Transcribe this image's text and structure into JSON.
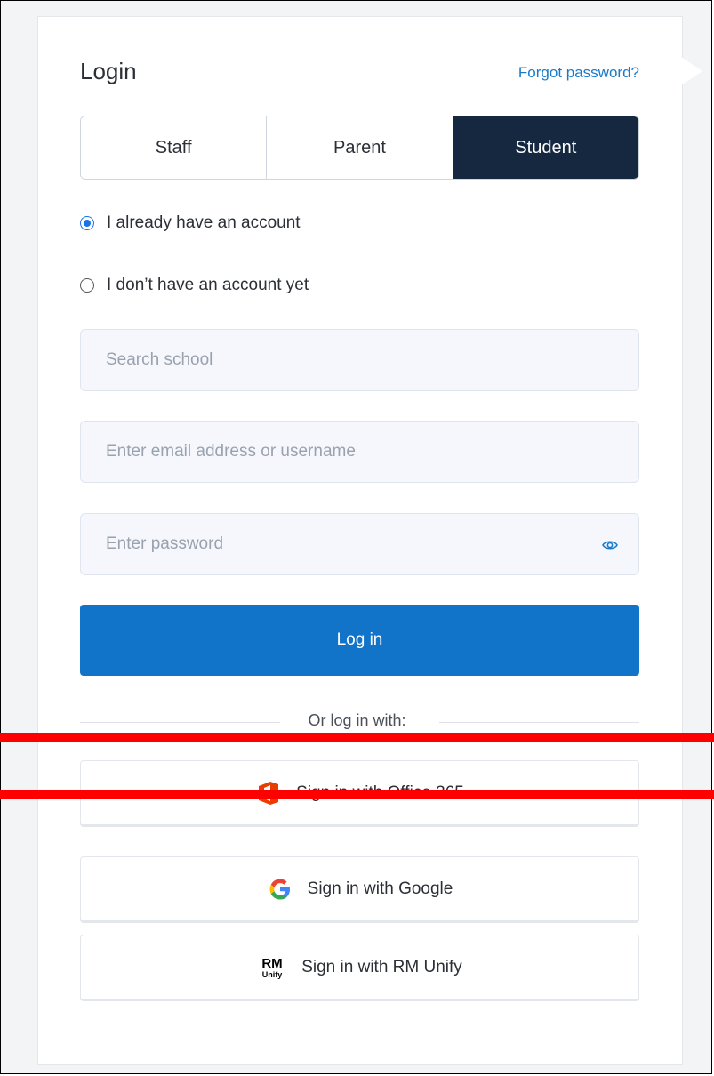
{
  "header": {
    "title": "Login",
    "forgot_link": "Forgot password?"
  },
  "role_tabs": [
    {
      "label": "Staff",
      "active": false
    },
    {
      "label": "Parent",
      "active": false
    },
    {
      "label": "Student",
      "active": true
    }
  ],
  "account_options": [
    {
      "label": "I already have an account",
      "checked": true
    },
    {
      "label": "I don’t have an account yet",
      "checked": false
    }
  ],
  "fields": {
    "school_placeholder": "Search school",
    "email_placeholder": "Enter email address or username",
    "password_placeholder": "Enter password",
    "password_toggle_icon": "eye-icon"
  },
  "login_button": "Log in",
  "alt_login": {
    "divider_text": "Or log in with:",
    "providers": [
      {
        "label": "Sign in with Office 365",
        "icon": "office365-icon"
      },
      {
        "label": "Sign in with Google",
        "icon": "google-icon"
      },
      {
        "label": "Sign in with RM Unify",
        "icon": "rm-unify-icon",
        "logo_text": "RM Unify"
      }
    ]
  },
  "colors": {
    "accent": "#1174c9",
    "active_tab": "#15283f",
    "link": "#1a7bc9",
    "annotation": "#ff0000"
  }
}
